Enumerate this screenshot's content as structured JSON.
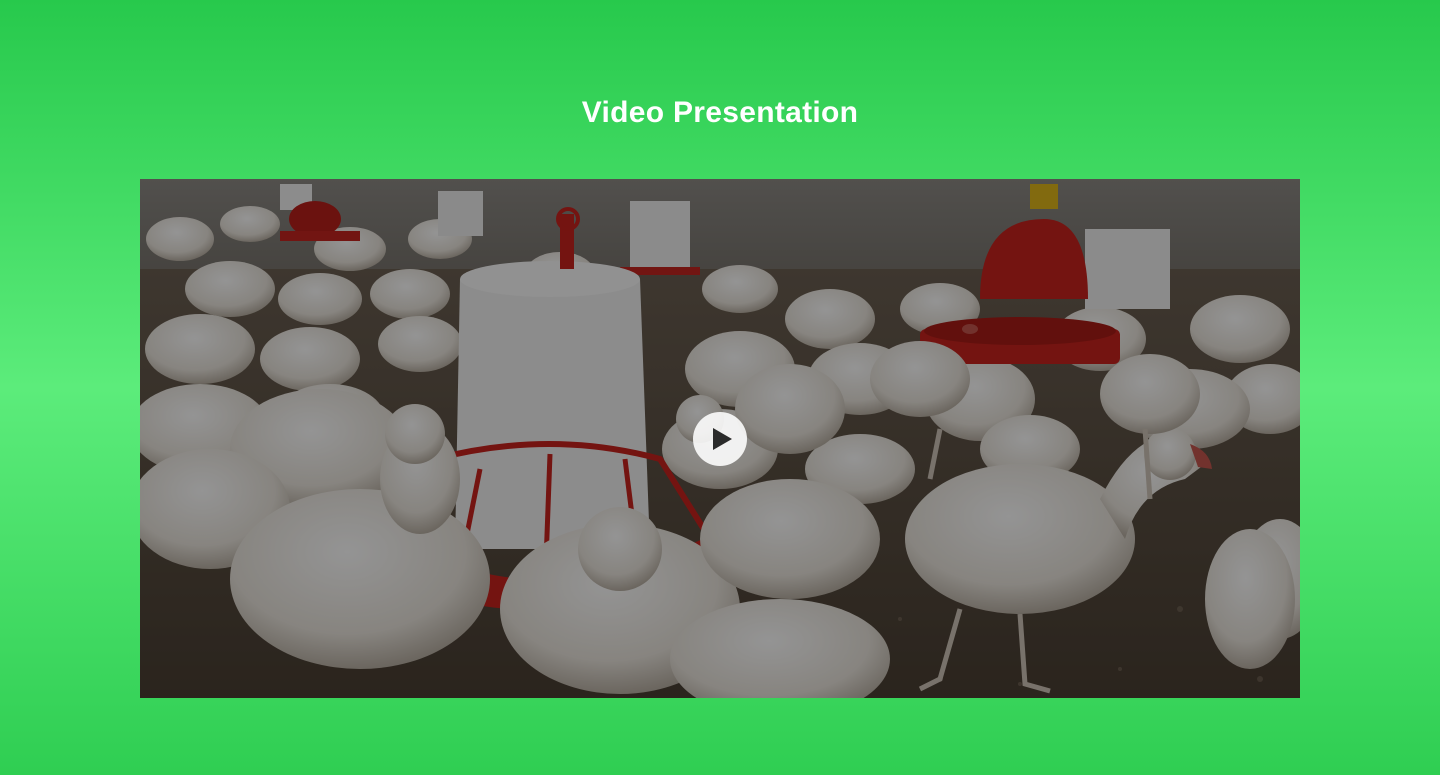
{
  "section": {
    "title": "Video Presentation"
  },
  "video": {
    "play_label": "Play video",
    "thumbnail_subject": "chickens-in-poultry-barn"
  },
  "colors": {
    "background_top": "#27c94c",
    "background_mid": "#5cec7b",
    "background_bottom": "#2fce52",
    "title_text": "#ffffff",
    "play_button": "#ffffff",
    "feeder_red": "#c8241e",
    "feeder_white": "#f2f2f2"
  },
  "icons": {
    "play": "play-icon"
  }
}
